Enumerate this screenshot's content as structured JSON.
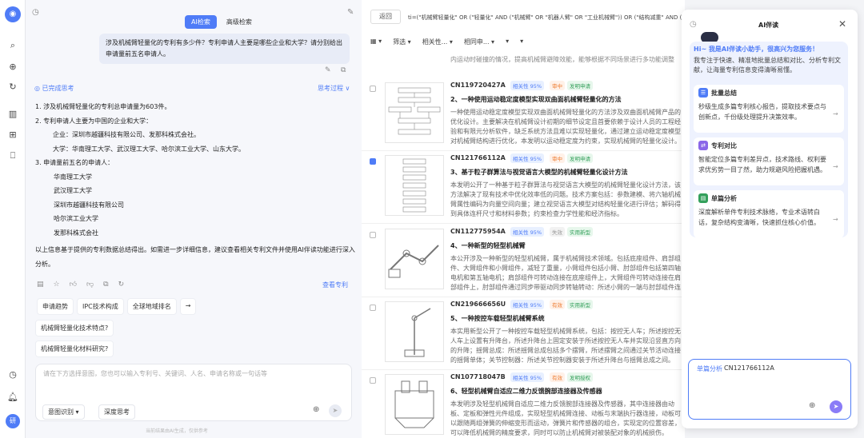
{
  "rail": {
    "logo": "◉",
    "user": "研"
  },
  "chat": {
    "tabs": [
      "AI检索",
      "高级检索"
    ],
    "question": "涉及机械臂轻量化的专利有多少件？专利申请人主要是哪些企业和大学？请分别给出申请量前五名申请人。",
    "thought_label": "已完成思考",
    "process_label": "思考过程 ∨",
    "answer": {
      "l1": "1.  涉及机械臂轻量化的专利总申请量为603件。",
      "l2": "2.  专利申请人主要为中国的企业和大学：",
      "l2a": "企业：深圳市越疆科技有限公司、发那科株式会社。",
      "l2b": "大学：华南理工大学、武汉理工大学、哈尔滨工业大学、山东大学。",
      "l3": "3.  申请量前五名的申请人：",
      "top5": [
        "华南理工大学",
        "武汉理工大学",
        "深圳市越疆科技有限公司",
        "哈尔滨工业大学",
        "发那科株式会社"
      ],
      "foot": "以上信息基于提供的专利数据总结得出。如需进一步详细信息，建议查看相关专利文件并使用AI伴读功能进行深入分析。"
    },
    "view_patents": "查看专利",
    "chips": [
      "申请趋势",
      "IPC技术构成",
      "全球地域排名",
      "→"
    ],
    "suggestions": [
      "机械臂轻量化技术特点?",
      "机械臂轻量化材料研究?"
    ],
    "input_placeholder": "请在下方选择意图，您也可以输入专利号、关键词、人名、申请名称或一句话等",
    "intent_btn": "意图识别 ▾",
    "deep_btn": "深度思考",
    "footnote": "当前结果由AI生成，仅供参考"
  },
  "results": {
    "back": "返回",
    "query": "ti=(\"机械臂轻量化\" OR (\"轻量化\" AND (\"机械臂\" OR \"机器人臂\" OR \"工业机械臂\")) OR (\"结构减重\" AND (\"机械臂\"",
    "toolbar": [
      "筛选 ▾",
      "相关性... ▾",
      "相同申... ▾",
      "▾",
      "▾"
    ],
    "top_text": "内运动时碰撞的情况，提高机械臂避障效能，能够根据不同场景进行多功能调整",
    "items": [
      {
        "pn": "CN119720427A",
        "rel": "相关性 95%",
        "status": "审中",
        "type": "发明申请",
        "title": "2、一种使用运动稳定度模型实现双曲面机械臂轻量化的方法",
        "abstract": "一种使用运动稳定度模型实现双曲面机械臂轻量化的方法涉及双曲面机械臂产品的优化设计。主要解决在机械臂设计初期的细节设定且首要依赖于设计人员的工程经验和有限元分析软件，缺乏系统方法且难以实现轻量化，通过建立运动稳定度模型对机械臂结构进行优化，本发明以运动稳定度为约束，实现机械臂的轻量化设计。"
      },
      {
        "pn": "CN121766112A",
        "rel": "相关性 95%",
        "status": "审中",
        "type": "发明申请",
        "title": "3、基于粒子群算法与视觉语言大模型的机械臂轻量化设计方法",
        "abstract": "本发明公开了一种基于粒子群算法与视觉语言大模型的机械臂轻量化设计方法，该方法解决了现有技术中优化效率低的问题。技术方案包括：参数建模、将六轴机械臂属性编码为向量空间向量；建立视觉语言大模型对结构轻量化进行评估；解码得到具体连杆尺寸和材料参数；约束检查力学性能和经济指标。"
      },
      {
        "pn": "CN112775954A",
        "rel": "相关性 95%",
        "status": "失效",
        "type": "实用新型",
        "title": "4、一种新型的轻型机械臂",
        "abstract": "本公开涉及一种新型的轻型机械臂，属于机械臂技术领域。包括底座组件、肩部组件、大臂组件和小臂组件，减轻了重量，小臂组件包括小臂、肘部组件包括第四轴电机和第五轴电机；肩部组件可转动连接在底座组件上，大臂组件可转动连接在肩部组件上，肘部组件通过同步带驱动同步转轴转动：所述小臂的一端与肘部组件连接。"
      },
      {
        "pn": "CN219666656U",
        "rel": "相关性 95%",
        "status": "有效",
        "type": "实用新型",
        "title": "5、一种按控车载轻型机械臂系统",
        "abstract": "本实用新型公开了一种按控车载轻型机械臂系统，包括：按控无人车；所述按控无人车上设置有升降台，所述升降台上固定安装于所述按控无人车并实现沿竖直方向的升降；揺臂总成：所述揺臂总成包括多个摆臂，所述摆臂之间通过关节活动连接的揺臂单体；关节控制器：所述关节控制器安装于所述升降台与揺臂总成之间。"
      },
      {
        "pn": "CN107718047B",
        "rel": "相关性 95%",
        "status": "有效",
        "type": "发明授权",
        "title": "6、轻型机械臂自适应二维力反馈腕部连接器及传感器",
        "abstract": "本发明涉及轻型机械臂自适应二维力反馈腕部连接器及传感器，其中连接器由动板、定板和弹性元件组成，实现轻型机械臂连接、动板与末端执行器连接，动板可以跟随两组弹簧的伸缩变形而运动，弹簧片和传感器的组合，实现定的位置容差，可以降低机械臂的精度要求，同时可以防止机械臂对被装配对象的机械损伤。"
      }
    ]
  },
  "ai": {
    "title": "AI伴读",
    "hi": "Hi~ 我是AI伴读小助手，很高兴为您服务！",
    "desc": "我专注于快速、精准地批量总结和对比、分析专利文献，让海量专利信息变得清晰易懂。",
    "cards": [
      {
        "icon": "☰",
        "color": "#4f7cf7",
        "title": "批量总结",
        "desc": "秒级生成多篇专利核心报告，提取技术要点与创新点，千份级处理提升决策效率。"
      },
      {
        "icon": "⇄",
        "color": "#8a66e8",
        "title": "专利对比",
        "desc": "智能定位多篇专利差异点，技术路线、权利要求优劣势一目了然，助力规避风险把握机遇。"
      },
      {
        "icon": "▤",
        "color": "#34a05b",
        "title": "单篇分析",
        "desc": "深度解析单件专利技术脉络，专业术语转白话，复杂结构变清晰，快速抓住核心价值。"
      }
    ],
    "input_label": "单篇分析",
    "input_value": "CN121766112A"
  }
}
